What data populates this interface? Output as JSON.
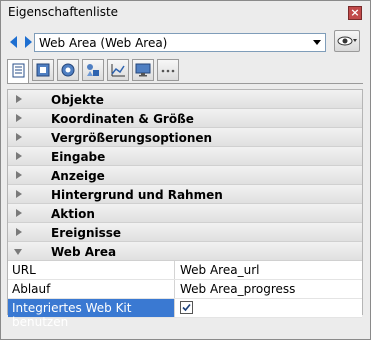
{
  "window": {
    "title": "Eigenschaftenliste"
  },
  "selector": {
    "value": "Web Area (Web Area)"
  },
  "icons": {
    "close": "close-icon",
    "nav": "nav-arrows-icon",
    "eye": "eye-icon",
    "tabs": [
      "properties-list-icon",
      "object-icon",
      "gear-icon",
      "shapes-icon",
      "chart-icon",
      "monitor-icon",
      "more-icon"
    ]
  },
  "categories": [
    {
      "label": "Objekte"
    },
    {
      "label": "Koordinaten & Größe"
    },
    {
      "label": "Vergrößerungsoptionen"
    },
    {
      "label": "Eingabe"
    },
    {
      "label": "Anzeige"
    },
    {
      "label": "Hintergrund und Rahmen"
    },
    {
      "label": "Aktion"
    },
    {
      "label": "Ereignisse"
    },
    {
      "label": "Web Area"
    }
  ],
  "properties": [
    {
      "name": "URL",
      "value": "Web Area_url"
    },
    {
      "name": "Ablauf",
      "value": "Web Area_progress"
    },
    {
      "name": "Integriertes Web Kit benutzen",
      "value": ""
    }
  ],
  "webkit_checkbox": {
    "checked": true
  },
  "colors": {
    "selection": "#3a79d2",
    "nav_arrow": "#1e6fd1"
  }
}
